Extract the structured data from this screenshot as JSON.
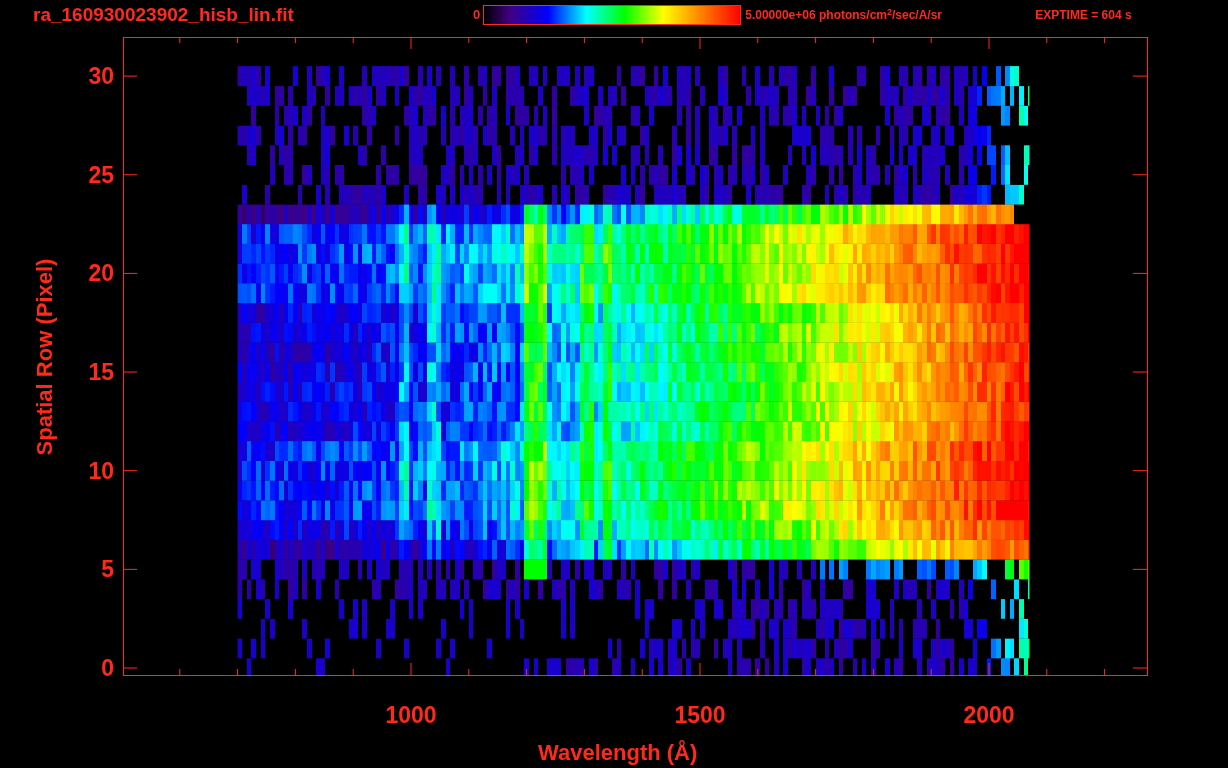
{
  "title": "ra_160930023902_hisb_lin.fit",
  "colorbar": {
    "min_label": "0",
    "max_label": "5.00000e+06 photons/cm$^{2}$/sec/A/sr"
  },
  "exposure": "EXPTIME = 604 s",
  "plot": {
    "xlabel": "Wavelength (Å)",
    "ylabel": "Spatial Row (Pixel)",
    "xticks": [
      "1000",
      "1500",
      "2000"
    ],
    "yticks": [
      "30",
      "25",
      "20",
      "15",
      "10",
      "5",
      "0"
    ]
  }
}
